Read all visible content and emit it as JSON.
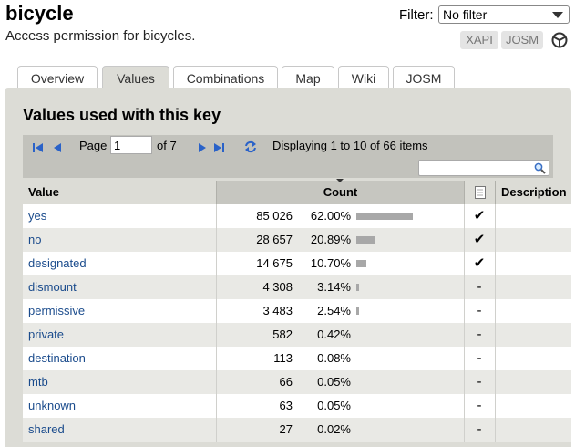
{
  "header": {
    "title": "bicycle",
    "subtitle": "Access permission for bicycles.",
    "filter_label": "Filter:",
    "filter_value": "No filter",
    "tool_buttons": [
      "XAPI",
      "JOSM"
    ],
    "josm_icon": "josm-icon"
  },
  "tabs": [
    "Overview",
    "Values",
    "Combinations",
    "Map",
    "Wiki",
    "JOSM"
  ],
  "active_tab": "Values",
  "panel": {
    "title": "Values used with this key",
    "pager": {
      "page_label": "Page",
      "page_value": "1",
      "of_label": "of 7",
      "display": "Displaying 1 to 10 of 66 items",
      "icons": [
        "first-page-icon",
        "prev-page-icon",
        "next-page-icon",
        "last-page-icon",
        "refresh-icon"
      ]
    },
    "search_placeholder": "",
    "columns": [
      "Value",
      "Count",
      "Description"
    ],
    "rows": [
      {
        "value": "yes",
        "count": "85 026",
        "percent": "62.00%",
        "fraction": 0.62,
        "wiki": "✔"
      },
      {
        "value": "no",
        "count": "28 657",
        "percent": "20.89%",
        "fraction": 0.2089,
        "wiki": "✔"
      },
      {
        "value": "designated",
        "count": "14 675",
        "percent": "10.70%",
        "fraction": 0.107,
        "wiki": "✔"
      },
      {
        "value": "dismount",
        "count": "4 308",
        "percent": "3.14%",
        "fraction": 0.0314,
        "wiki": "-"
      },
      {
        "value": "permissive",
        "count": "3 483",
        "percent": "2.54%",
        "fraction": 0.0254,
        "wiki": "-"
      },
      {
        "value": "private",
        "count": "582",
        "percent": "0.42%",
        "fraction": 0.0042,
        "wiki": "-"
      },
      {
        "value": "destination",
        "count": "113",
        "percent": "0.08%",
        "fraction": 0.0008,
        "wiki": "-"
      },
      {
        "value": "mtb",
        "count": "66",
        "percent": "0.05%",
        "fraction": 0.0005,
        "wiki": "-"
      },
      {
        "value": "unknown",
        "count": "63",
        "percent": "0.05%",
        "fraction": 0.0005,
        "wiki": "-"
      },
      {
        "value": "shared",
        "count": "27",
        "percent": "0.02%",
        "fraction": 0.0002,
        "wiki": "-"
      }
    ]
  }
}
